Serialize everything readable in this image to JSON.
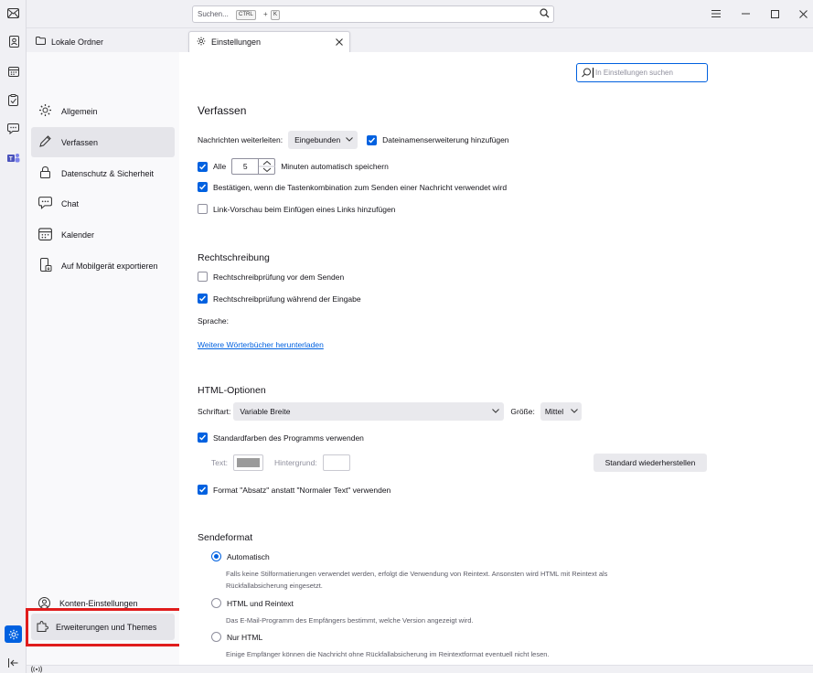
{
  "titlebar": {
    "search_placeholder": "Suchen...",
    "shortcut_key1": "CTRL",
    "shortcut_plus": "+",
    "shortcut_key2": "K"
  },
  "tabs": {
    "folder_label": "Lokale Ordner",
    "settings_label": "Einstellungen"
  },
  "sidebar": {
    "items": [
      {
        "label": "Allgemein"
      },
      {
        "label": "Verfassen"
      },
      {
        "label": "Datenschutz & Sicherheit"
      },
      {
        "label": "Chat"
      },
      {
        "label": "Kalender"
      },
      {
        "label": "Auf Mobilgerät exportieren"
      }
    ],
    "bottom_items": [
      {
        "label": "Konten-Einstellungen"
      },
      {
        "label": "Erweiterungen und Themes"
      }
    ]
  },
  "find": {
    "placeholder": "In Einstellungen suchen"
  },
  "compose": {
    "heading": "Verfassen",
    "forward_label": "Nachrichten weiterleiten:",
    "forward_value": "Eingebunden",
    "extension_label": "Dateinamenserweiterung hinzufügen",
    "autosave_prefix": "Alle",
    "autosave_value": "5",
    "autosave_suffix": "Minuten automatisch speichern",
    "confirm_label": "Bestätigen, wenn die Tastenkombination zum Senden einer Nachricht verwendet wird",
    "linkpreview_label": "Link-Vorschau beim Einfügen eines Links hinzufügen"
  },
  "spelling": {
    "heading": "Rechtschreibung",
    "before_send_label": "Rechtschreibprüfung vor dem Senden",
    "while_typing_label": "Rechtschreibprüfung während der Eingabe",
    "language_label": "Sprache:",
    "more_dicts_link": "Weitere Wörterbücher herunterladen"
  },
  "html_options": {
    "heading": "HTML-Optionen",
    "font_label": "Schriftart:",
    "font_value": "Variable Breite",
    "size_label": "Größe:",
    "size_value": "Mittel",
    "default_colors_label": "Standardfarben des Programms verwenden",
    "text_label": "Text:",
    "background_label": "Hintergrund:",
    "text_color": "#9b9b9b",
    "background_color": "#ffffff",
    "restore_button": "Standard wiederherstellen",
    "paragraph_label": "Format \"Absatz\" anstatt \"Normaler Text\" verwenden"
  },
  "send_format": {
    "heading": "Sendeformat",
    "options": [
      {
        "label": "Automatisch",
        "desc": "Falls keine Stilformatierungen verwendet werden, erfolgt die Verwendung von Reintext. Ansonsten wird HTML mit Reintext als Rückfallabsicherung eingesetzt."
      },
      {
        "label": "HTML und Reintext",
        "desc": "Das E-Mail-Programm des Empfängers bestimmt, welche Version angezeigt wird."
      },
      {
        "label": "Nur HTML",
        "desc": "Einige Empfänger können die Nachricht ohne Rückfallabsicherung im Reintextformat eventuell nicht lesen."
      }
    ]
  },
  "colors": {
    "accent": "#0061e0",
    "highlight_box": "#e01c1c"
  }
}
